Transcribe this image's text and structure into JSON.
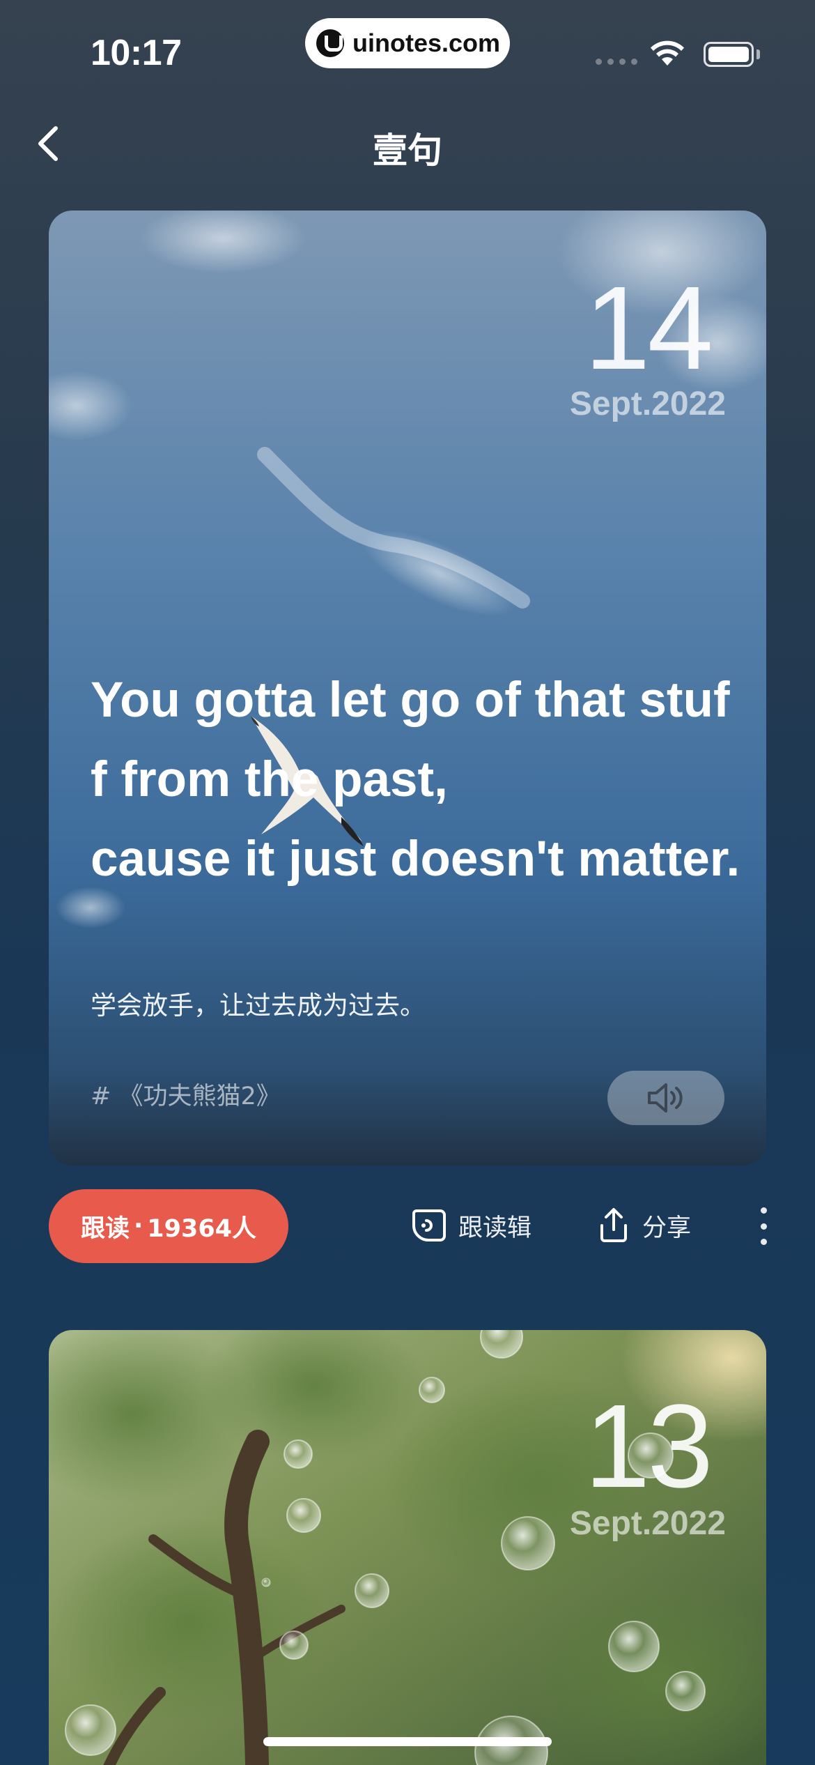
{
  "status_bar": {
    "time": "10:17",
    "url_pill": "uinotes.com"
  },
  "nav": {
    "title": "壹句",
    "back_icon": "chevron-left-icon"
  },
  "cards": [
    {
      "day": "14",
      "month_year": "Sept.2022",
      "quote_en": "You gotta let go of that stuff from the past,\ncause it just doesn't matter.",
      "quote_cn": "学会放手，让过去成为过去。",
      "source": "# 《功夫熊猫2》",
      "audio_icon": "speaker-icon",
      "background": "sky-with-seagull"
    },
    {
      "day": "13",
      "month_year": "Sept.2022",
      "background": "forest-with-bubbles"
    }
  ],
  "actions": {
    "follow_label": "跟读",
    "follow_separator": "·",
    "follow_count": "19364人",
    "followlist_label": "跟读辑",
    "share_label": "分享",
    "more_icon": "more-vertical-icon"
  },
  "colors": {
    "accent": "#e85a4b",
    "background_top": "#364250",
    "background_bottom": "#183a5c"
  }
}
